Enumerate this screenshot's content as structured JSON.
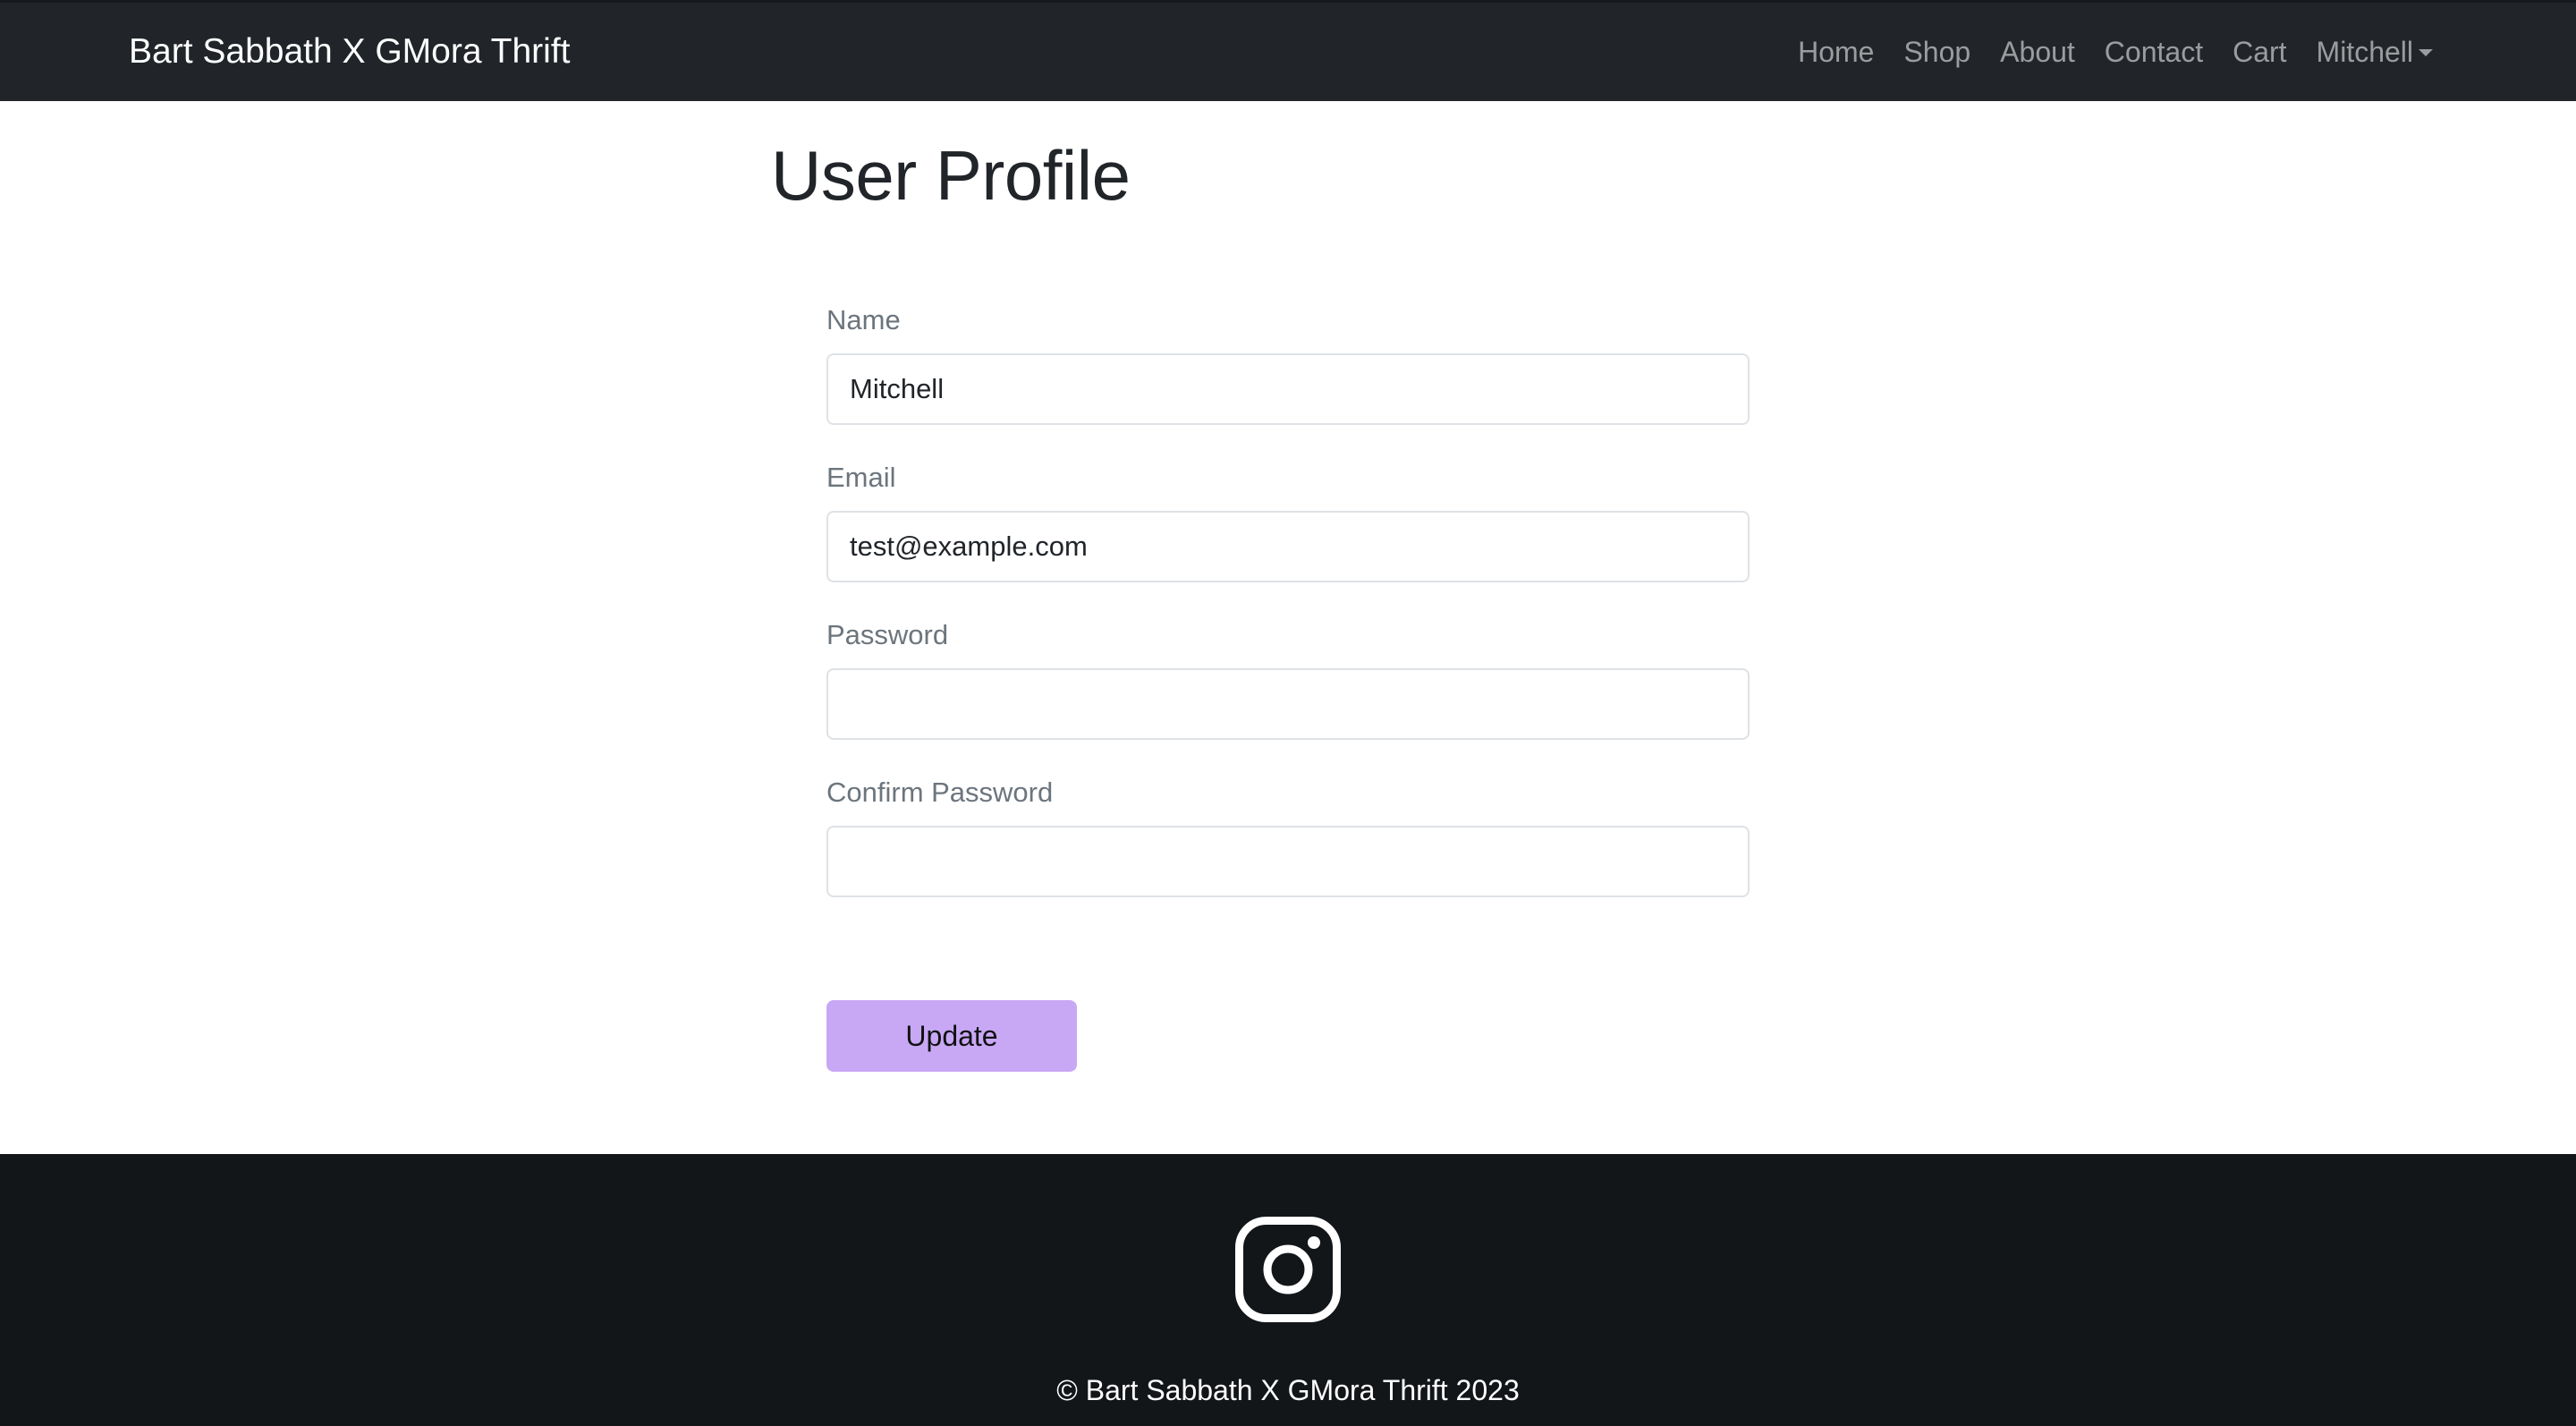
{
  "navbar": {
    "brand": "Bart Sabbath X GMora Thrift",
    "links": [
      "Home",
      "Shop",
      "About",
      "Contact",
      "Cart"
    ],
    "user_menu": "Mitchell"
  },
  "main": {
    "title": "User Profile",
    "fields": [
      {
        "label": "Name",
        "value": "Mitchell",
        "placeholder": ""
      },
      {
        "label": "Email",
        "value": "test@example.com",
        "placeholder": ""
      },
      {
        "label": "Password",
        "value": "",
        "placeholder": ""
      },
      {
        "label": "Confirm Password",
        "value": "",
        "placeholder": ""
      }
    ],
    "update_button": "Update"
  },
  "footer": {
    "icon": "instagram-icon",
    "copyright": "© Bart Sabbath X GMora Thrift 2023"
  },
  "colors": {
    "navbar_bg": "#212529",
    "footer_bg": "#131619",
    "button_bg": "#c8a8f5"
  }
}
